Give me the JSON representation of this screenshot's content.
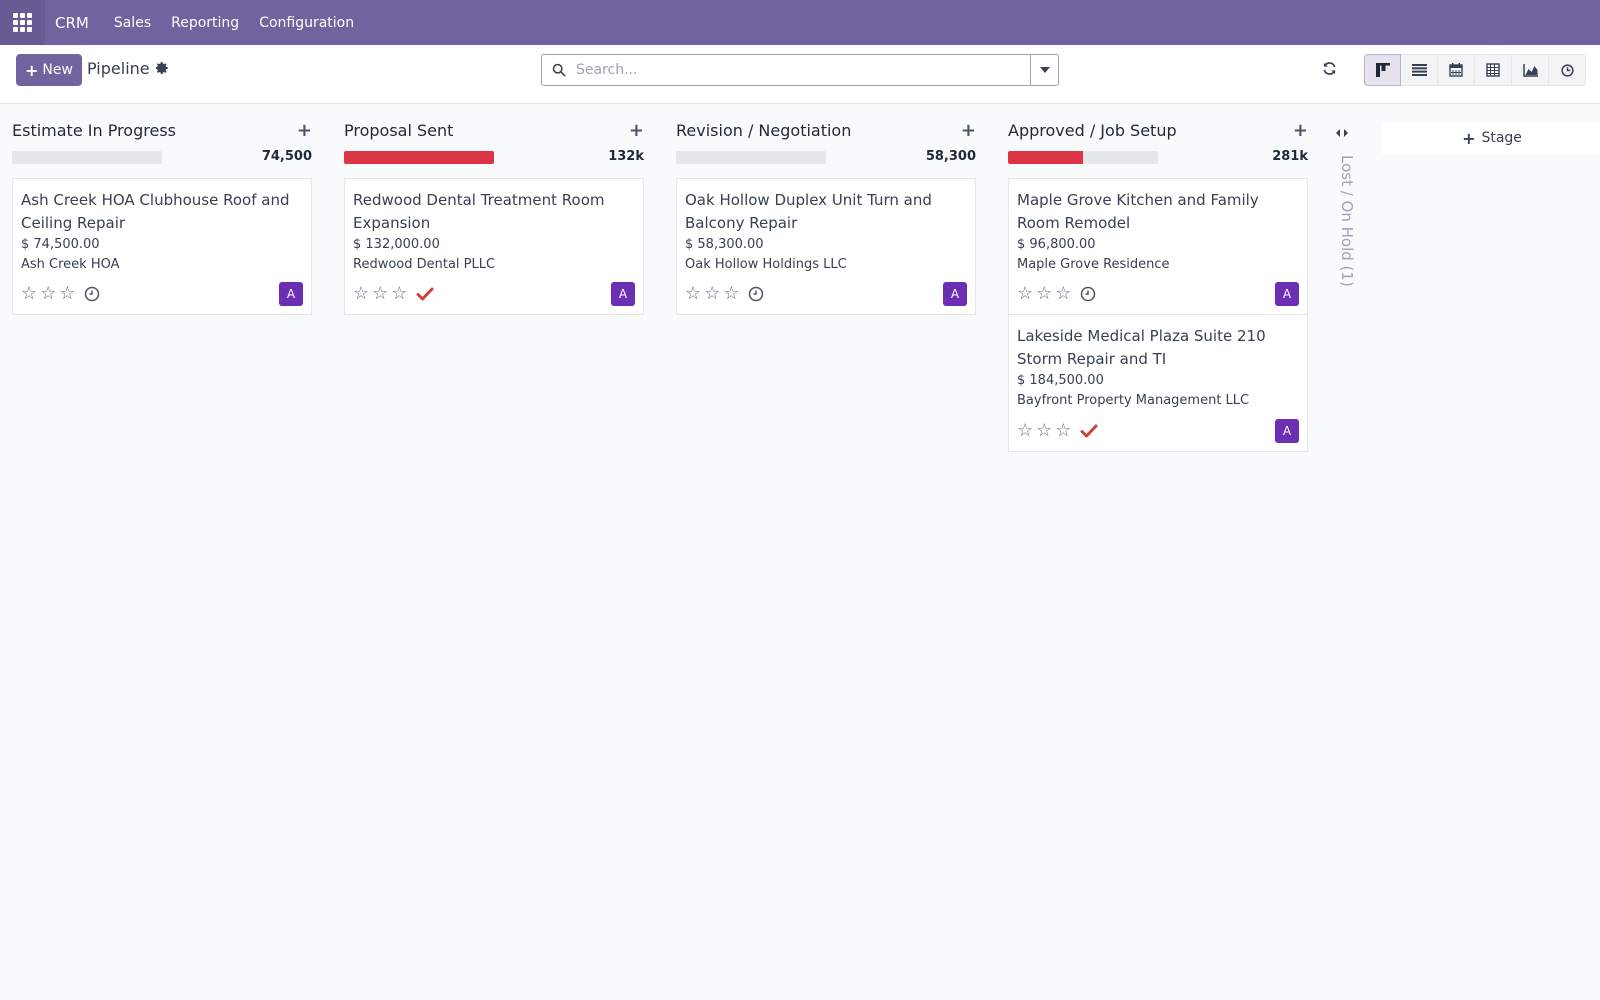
{
  "nav": {
    "brand": "CRM",
    "menu": [
      "Sales",
      "Reporting",
      "Configuration"
    ]
  },
  "control": {
    "new_label": "New",
    "title": "Pipeline",
    "search_placeholder": "Search...",
    "active_view": "kanban",
    "views": [
      "kanban-icon",
      "list-icon",
      "calendar-icon",
      "pivot-icon",
      "graph-icon",
      "activity-icon"
    ]
  },
  "colors": {
    "nav_bg": "#71639e",
    "progress_red": "#dc3545",
    "avatar": "#6b2fb3",
    "done_check": "#d23f3a"
  },
  "columns": [
    {
      "title": "Estimate In Progress",
      "total": "74,500",
      "progress_fraction": 0,
      "cards": [
        {
          "name": "Ash Creek HOA Clubhouse Roof and Ceiling Repair",
          "amount": "$ 74,500.00",
          "partner": "Ash Creek HOA",
          "activity": "clock-icon",
          "avatar": "A",
          "stars": 0
        }
      ]
    },
    {
      "title": "Proposal Sent",
      "total": "132k",
      "progress_fraction": 1,
      "cards": [
        {
          "name": "Redwood Dental Treatment Room Expansion",
          "amount": "$ 132,000.00",
          "partner": "Redwood Dental PLLC",
          "activity": "check-icon",
          "avatar": "A",
          "stars": 0
        }
      ]
    },
    {
      "title": "Revision / Negotiation",
      "total": "58,300",
      "progress_fraction": 0,
      "cards": [
        {
          "name": "Oak Hollow Duplex Unit Turn and Balcony Repair",
          "amount": "$ 58,300.00",
          "partner": "Oak Hollow Holdings LLC",
          "activity": "clock-icon",
          "avatar": "A",
          "stars": 0
        }
      ]
    },
    {
      "title": "Approved / Job Setup",
      "total": "281k",
      "progress_fraction": 0.5,
      "cards": [
        {
          "name": "Maple Grove Kitchen and Family Room Remodel",
          "amount": "$ 96,800.00",
          "partner": "Maple Grove Residence",
          "activity": "clock-icon",
          "avatar": "A",
          "stars": 0
        },
        {
          "name": "Lakeside Medical Plaza Suite 210 Storm Repair and TI",
          "amount": "$ 184,500.00",
          "partner": "Bayfront Property Management LLC",
          "activity": "check-icon",
          "avatar": "A",
          "stars": 0
        }
      ]
    }
  ],
  "folded_column": {
    "label": "Lost / On Hold (1)"
  },
  "add_stage_label": "Stage"
}
